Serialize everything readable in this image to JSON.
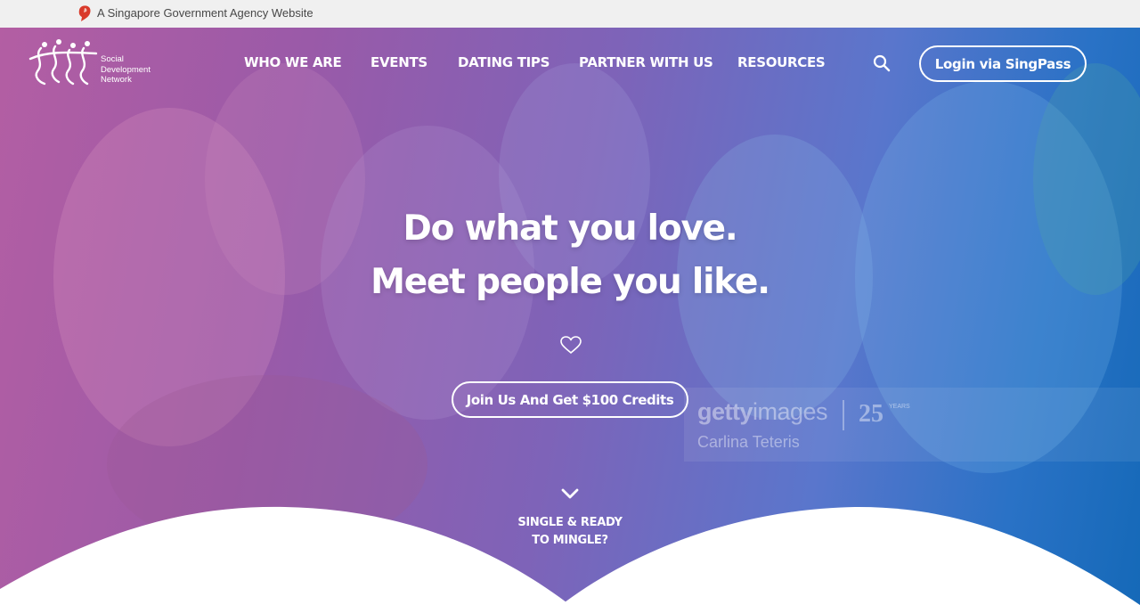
{
  "gov_banner": {
    "text": "A Singapore Government Agency Website",
    "icon": "lion-head-icon"
  },
  "logo": {
    "line1": "Social",
    "line2": "Development",
    "line3": "Network"
  },
  "nav": {
    "items": [
      {
        "label": "WHO WE ARE"
      },
      {
        "label": "EVENTS"
      },
      {
        "label": "DATING TIPS"
      },
      {
        "label": "PARTNER WITH US"
      },
      {
        "label": "RESOURCES"
      }
    ],
    "search_icon": "search-icon",
    "login_label": "Login via SingPass"
  },
  "hero": {
    "headline_1": "Do what you love.",
    "headline_2": "Meet people you like.",
    "cta_label": "Join Us And Get $100 Credits",
    "scroll_line_1": "SINGLE & READY",
    "scroll_line_2": "TO MINGLE?",
    "watermark_brand_bold": "getty",
    "watermark_brand_light": "images",
    "watermark_years": "25",
    "watermark_years_sub": "YEARS",
    "watermark_credit": "Carlina Teteris"
  },
  "colors": {
    "gradient_left": "#b35ea3",
    "gradient_right": "#1569b8",
    "gov_bar_bg": "#f0f0f0"
  }
}
